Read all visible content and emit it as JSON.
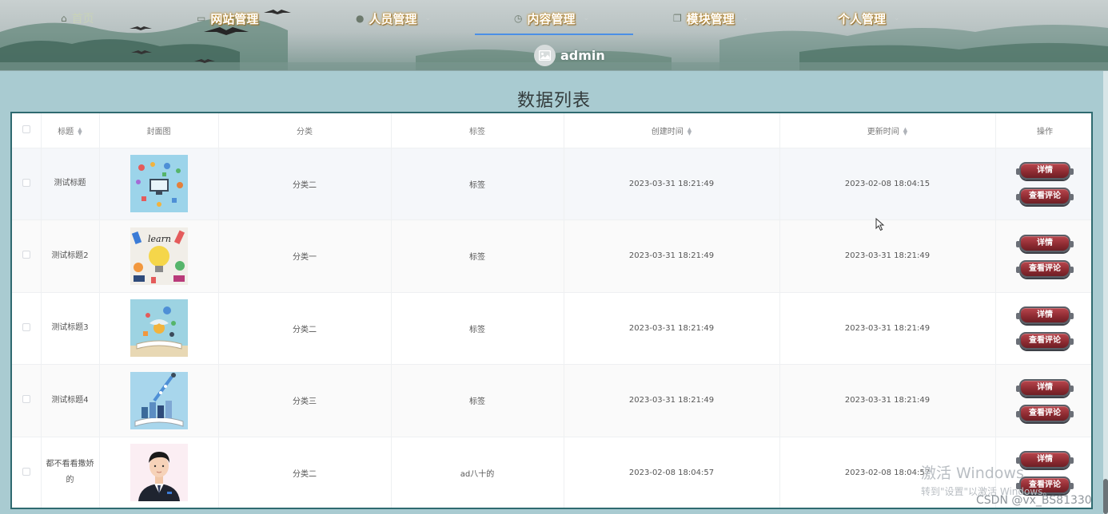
{
  "nav": {
    "items": [
      {
        "label": "首页",
        "icon": "home-icon"
      },
      {
        "label": "网站管理",
        "icon": "monitor-icon"
      },
      {
        "label": "人员管理",
        "icon": "user-icon"
      },
      {
        "label": "内容管理",
        "icon": "clock-icon"
      },
      {
        "label": "模块管理",
        "icon": "copy-icon"
      },
      {
        "label": "个人管理",
        "icon": ""
      }
    ],
    "active": "内容管理",
    "chevron": "⌄"
  },
  "user": {
    "name": "admin",
    "avatar_icon": "image-icon"
  },
  "page_title": "数据列表",
  "table": {
    "columns": [
      "标题",
      "封面图",
      "分类",
      "标签",
      "创建时间",
      "更新时间",
      "操作"
    ],
    "sortable": [
      "标题",
      "创建时间",
      "更新时间"
    ],
    "rows": [
      {
        "title": "测试标题",
        "category": "分类二",
        "tag": "标签",
        "created": "2023-03-31 18:21:49",
        "updated": "2023-02-08 18:04:15",
        "cover": "web-icons"
      },
      {
        "title": "测试标题2",
        "category": "分类一",
        "tag": "标签",
        "created": "2023-03-31 18:21:49",
        "updated": "2023-03-31 18:21:49",
        "cover": "learn-lightbulb"
      },
      {
        "title": "测试标题3",
        "category": "分类二",
        "tag": "标签",
        "created": "2023-03-31 18:21:49",
        "updated": "2023-03-31 18:21:49",
        "cover": "open-book-elements"
      },
      {
        "title": "测试标题4",
        "category": "分类三",
        "tag": "标签",
        "created": "2023-03-31 18:21:49",
        "updated": "2023-03-31 18:21:49",
        "cover": "book-city"
      },
      {
        "title": "都不看看撒娇的",
        "category": "分类二",
        "tag": "ad八十的",
        "created": "2023-02-08 18:04:57",
        "updated": "2023-02-08 18:04:57",
        "cover": "man-portrait"
      }
    ],
    "actions": {
      "detail": "详情",
      "comments": "查看评论"
    }
  },
  "watermark": {
    "line1": "激活 Windows",
    "line2": "转到\"设置\"以激活 Windows。"
  },
  "csdn": "CSDN @vx_BS81330",
  "colors": {
    "accent": "#4b8fe6",
    "table_border": "#2f6a70",
    "button": "#8c2a31",
    "page_bg": "#a9cbd1"
  }
}
